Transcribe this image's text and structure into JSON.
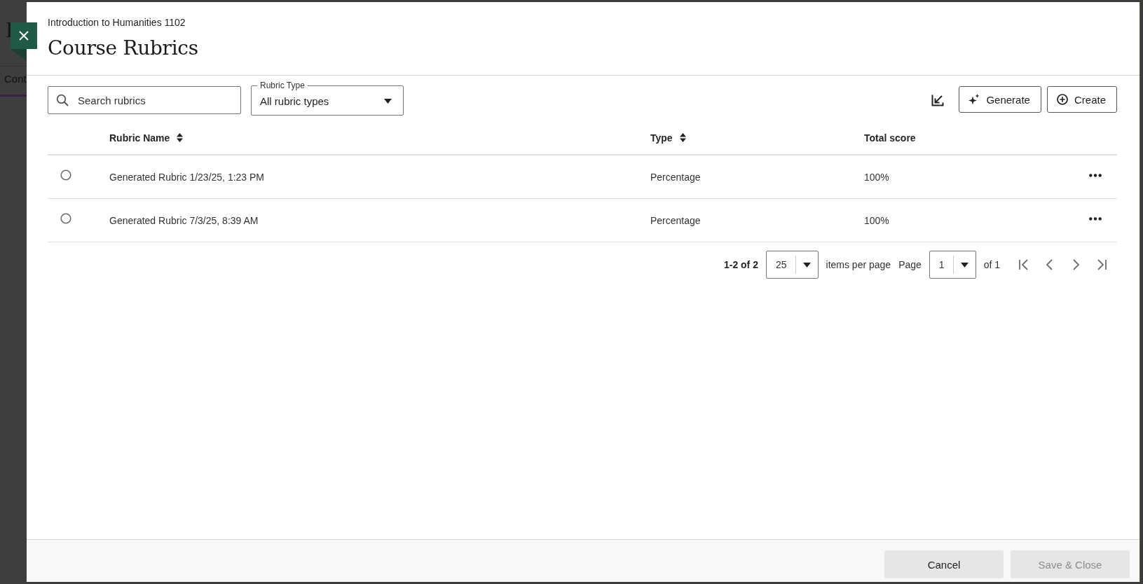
{
  "background": {
    "heading": "I",
    "tab": "Cont"
  },
  "dialog": {
    "subtitle": "Introduction to Humanities 1102",
    "title": "Course Rubrics"
  },
  "search": {
    "placeholder": "Search rubrics"
  },
  "filter": {
    "label": "Rubric Type",
    "value": "All rubric types"
  },
  "actions": [
    {
      "label": "Generate",
      "kind": "generate"
    },
    {
      "label": "Create",
      "kind": "create"
    }
  ],
  "table": {
    "columns": [
      {
        "label": "Rubric Name",
        "sortable": true
      },
      {
        "label": "Type",
        "sortable": true
      },
      {
        "label": "Total score",
        "sortable": false
      }
    ],
    "rows": [
      {
        "name": "Generated Rubric 1/23/25, 1:23 PM",
        "type": "Percentage",
        "score": "100%",
        "selected": false
      },
      {
        "name": "Generated Rubric 7/3/25, 8:39 AM",
        "type": "Percentage",
        "score": "100%",
        "selected": false
      }
    ]
  },
  "pagination": {
    "range": "1-2 of 2",
    "per_page": "25",
    "per_page_label": "items per page",
    "page_label": "Page",
    "page": "1",
    "page_total": "of 1"
  },
  "footer": {
    "buttons": [
      {
        "label": "Cancel",
        "disabled": false
      },
      {
        "label": "Save & Close",
        "disabled": true
      }
    ]
  }
}
